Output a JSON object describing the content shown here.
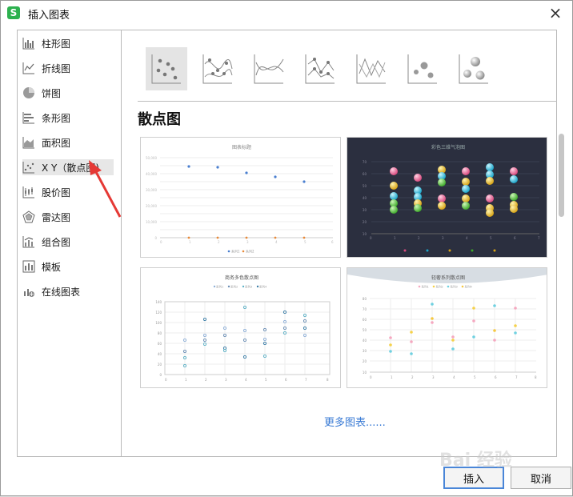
{
  "window": {
    "title": "插入图表",
    "app_icon_letter": "S",
    "close_symbol": "×"
  },
  "sidebar": {
    "items": [
      {
        "label": "柱形图",
        "icon": "bar-chart-icon"
      },
      {
        "label": "折线图",
        "icon": "line-chart-icon"
      },
      {
        "label": "饼图",
        "icon": "pie-chart-icon"
      },
      {
        "label": "条形图",
        "icon": "horizontal-bar-icon"
      },
      {
        "label": "面积图",
        "icon": "area-chart-icon"
      },
      {
        "label": "X Y（散点图)",
        "icon": "scatter-icon",
        "selected": true
      },
      {
        "label": "股价图",
        "icon": "stock-chart-icon"
      },
      {
        "label": "雷达图",
        "icon": "radar-chart-icon"
      },
      {
        "label": "组合图",
        "icon": "combo-chart-icon"
      },
      {
        "label": "模板",
        "icon": "template-icon"
      },
      {
        "label": "在线图表",
        "icon": "online-chart-icon"
      }
    ]
  },
  "subtypes": [
    {
      "icon": "scatter-markers-icon",
      "selected": true
    },
    {
      "icon": "scatter-smooth-markers-icon"
    },
    {
      "icon": "scatter-smooth-lines-icon"
    },
    {
      "icon": "scatter-straight-markers-icon"
    },
    {
      "icon": "scatter-straight-lines-icon"
    },
    {
      "icon": "bubble-icon"
    },
    {
      "icon": "bubble-3d-icon"
    }
  ],
  "section": {
    "title": "散点图"
  },
  "cards": [
    {
      "title": "图表标题",
      "legend": [
        "系列1",
        "系列2"
      ],
      "theme": "light"
    },
    {
      "title": "彩色三维气泡图",
      "theme": "dark"
    },
    {
      "title": "商务多色散点图",
      "legend": [
        "系列1",
        "系列2",
        "系列3",
        "系列4"
      ],
      "theme": "light"
    },
    {
      "title": "轻奢系列散点图",
      "legend": [
        "系列1",
        "系列2",
        "系列3",
        "系列4"
      ],
      "theme": "light"
    }
  ],
  "more_link": "更多图表......",
  "buttons": {
    "insert": "插入",
    "cancel": "取消"
  },
  "watermark": "Bai 经验",
  "colors": {
    "accent": "#4a86d8",
    "link": "#3a7bd5",
    "annotation_arrow": "#e53935"
  }
}
